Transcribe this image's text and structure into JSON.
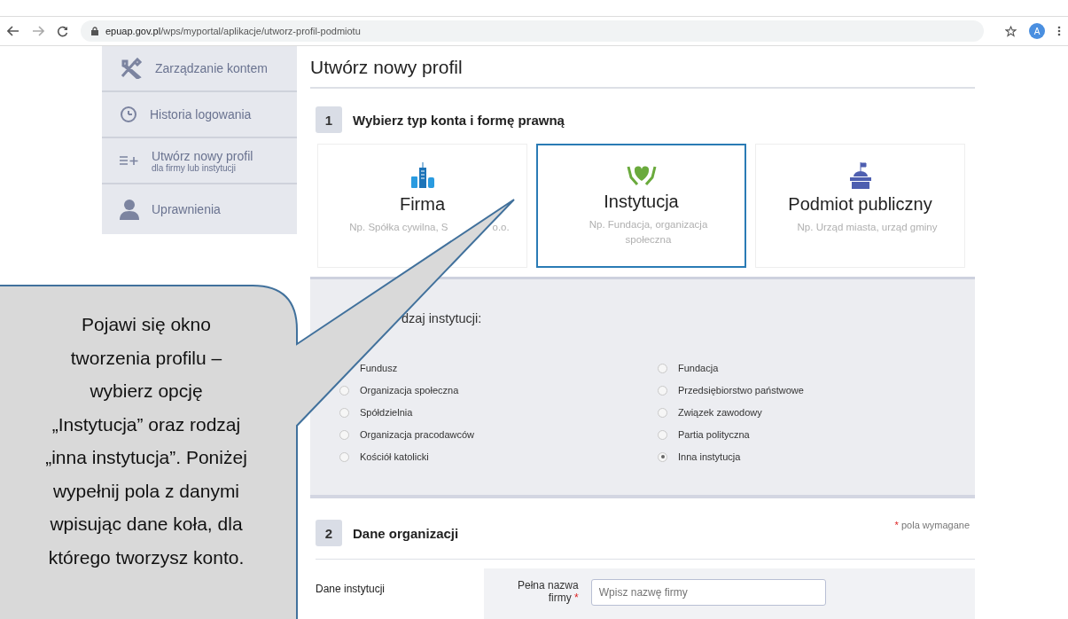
{
  "browser": {
    "url_host": "epuap.gov.pl",
    "url_path": "/wps/myportal/aplikacje/utworz-profil-podmiotu",
    "avatar": "A"
  },
  "sidebar": {
    "items": [
      {
        "kind": "tools",
        "label": "Zarządzanie kontem"
      },
      {
        "kind": "clock",
        "label": "Historia logowania"
      },
      {
        "kind": "list-plus",
        "label": "Utwórz nowy profil",
        "sub": "dla firmy lub instytucji"
      },
      {
        "kind": "person",
        "label": "Uprawnienia"
      }
    ]
  },
  "page_title": "Utwórz nowy profil",
  "section1": {
    "number": "1",
    "title": "Wybierz typ konta i formę prawną",
    "cards": [
      {
        "kind": "buildings",
        "title": "Firma",
        "subtitle": "Np. Spółka cywilna, S",
        "subtitle_end": "o.o.",
        "selected": false
      },
      {
        "kind": "heart-hands",
        "title": "Instytucja",
        "subtitle": "Np. Fundacja, organizacja społeczna",
        "selected": true
      },
      {
        "kind": "public-building",
        "title": "Podmiot publiczny",
        "subtitle": "Np. Urząd miasta, urząd gminy",
        "selected": false
      }
    ],
    "type_heading": "dzaj instytucji:",
    "options": [
      {
        "label": "Fundusz"
      },
      {
        "label": "Fundacja",
        "selected": false
      },
      {
        "label": "Organizacja społeczna",
        "selected": false
      },
      {
        "label": "Przedsiębiorstwo państwowe",
        "selected": false
      },
      {
        "label": "Spółdzielnia",
        "selected": false
      },
      {
        "label": "Związek zawodowy",
        "selected": false
      },
      {
        "label": "Organizacja pracodawców",
        "selected": false
      },
      {
        "label": "Partia polityczna",
        "selected": false
      },
      {
        "label": "Kościół katolicki",
        "selected": false
      },
      {
        "label": "Inna instytucja",
        "selected": true
      }
    ]
  },
  "section2": {
    "number": "2",
    "title": "Dane organizacji",
    "required_mark": "*",
    "required_note": "pola wymagane",
    "group_label": "Dane instytucji",
    "field_label": "Pełna nazwa",
    "field_label_cut": "firmy",
    "field_placeholder": "Wpisz nazwę firmy"
  },
  "callout": {
    "text": "Pojawi się okno\ntworzenia profilu –\nwybierz opcję\n„Instytucja” oraz rodzaj\n„inna instytucja”. Poniżej\nwypełnij pola z danymi\nwpisując dane koła, dla\nktórego tworzysz konto."
  }
}
